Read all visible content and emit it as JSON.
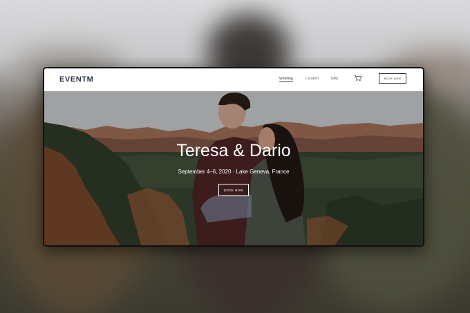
{
  "nav": {
    "logo": "EVENTM",
    "links": [
      "Wedding",
      "Location",
      "Gifts"
    ],
    "active_link": "Wedding",
    "book_label": "BOOK NOW",
    "cart_icon": "cart-icon"
  },
  "hero": {
    "title": "Teresa & Dario",
    "subtitle": "September 4–6, 2020 · Lake Geneva, France",
    "cta_label": "BOOK NOW"
  }
}
